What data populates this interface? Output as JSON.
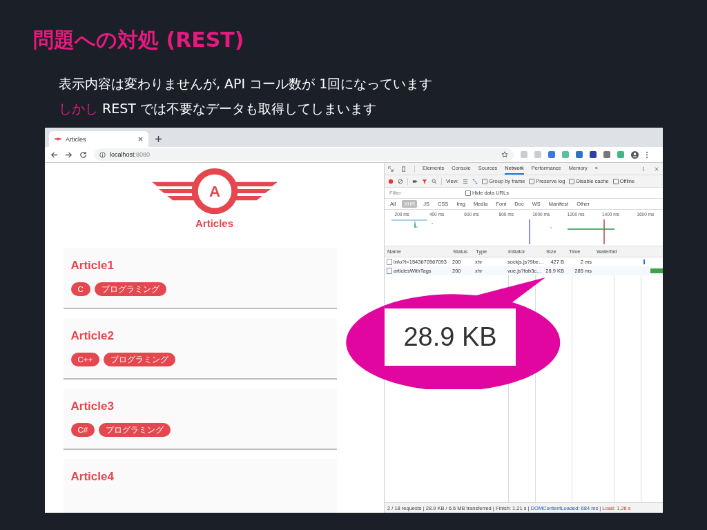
{
  "slide": {
    "title": "問題への対処 (REST)",
    "lines": [
      {
        "text": "表示内容は変わりませんが, API コール数が 1回になっています"
      },
      {
        "lead": "しかし",
        "text": "REST では不要なデータも取得してしまいます"
      }
    ]
  },
  "browser": {
    "tab_title": "Articles",
    "url_host": "localhost",
    "url_port": ":8080"
  },
  "page": {
    "logo_letter": "A",
    "logo_text": "Articles",
    "articles": [
      {
        "title": "Article1",
        "tags": [
          "C",
          "プログラミング"
        ]
      },
      {
        "title": "Article2",
        "tags": [
          "C++",
          "プログラミング"
        ]
      },
      {
        "title": "Article3",
        "tags": [
          "C#",
          "プログラミング"
        ]
      },
      {
        "title": "Article4"
      }
    ]
  },
  "devtools": {
    "tabs": [
      {
        "label": "Elements",
        "selected": false
      },
      {
        "label": "Console",
        "selected": false
      },
      {
        "label": "Sources",
        "selected": false
      },
      {
        "label": "Network",
        "selected": true
      },
      {
        "label": "Performance",
        "selected": false
      },
      {
        "label": "Memory",
        "selected": false
      },
      {
        "label": "»",
        "selected": false
      }
    ],
    "view_label": "View:",
    "options": [
      {
        "label": "Group by frame",
        "checked": false
      },
      {
        "label": "Preserve log",
        "checked": false
      },
      {
        "label": "Disable cache",
        "checked": false
      },
      {
        "label": "Offline",
        "checked": false
      }
    ],
    "filter": {
      "placeholder": "Filter"
    },
    "hide_data_urls": {
      "label": "Hide data URLs",
      "checked": false
    },
    "types": [
      {
        "label": "All",
        "selected": false
      },
      {
        "label": "XHR",
        "selected": true
      },
      {
        "label": "JS",
        "selected": false
      },
      {
        "label": "CSS",
        "selected": false
      },
      {
        "label": "Img",
        "selected": false
      },
      {
        "label": "Media",
        "selected": false
      },
      {
        "label": "Font",
        "selected": false
      },
      {
        "label": "Doc",
        "selected": false
      },
      {
        "label": "WS",
        "selected": false
      },
      {
        "label": "Manifest",
        "selected": false
      },
      {
        "label": "Other",
        "selected": false
      }
    ],
    "timeline_ticks": [
      "200 ms",
      "400 ms",
      "600 ms",
      "800 ms",
      "1000 ms",
      "1200 ms",
      "1400 ms",
      "1600 ms"
    ],
    "columns": [
      "Name",
      "Status",
      "Type",
      "Initiator",
      "Size",
      "Time",
      "Waterfall"
    ],
    "rows": [
      {
        "cells": [
          "info?t=1543670567093",
          "200",
          "xhr",
          "sockjs.js?9be…",
          "427 B",
          "2 ms"
        ]
      },
      {
        "cells": [
          "articlesWithTags",
          "200",
          "xhr",
          "vue.js?fab3c…",
          "28.9 KB",
          "285 ms"
        ]
      }
    ],
    "status": "2 / 18 requests | 28.9 KB / 6.6 MB transferred | Finish: 1.21 s | ",
    "dcl": "DOMContentLoaded: 684 ms",
    "sep": " | ",
    "load": "Load: 1.26 s"
  },
  "callout": {
    "text": "28.9 KB"
  }
}
